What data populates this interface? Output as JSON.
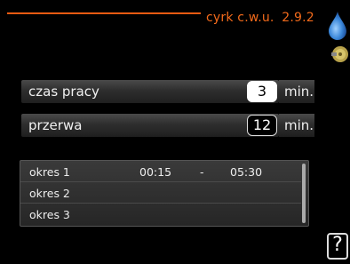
{
  "header": {
    "menu_title": "cyrk c.w.u.",
    "menu_number": "2.9.2"
  },
  "icons": {
    "water": "water-drop-icon",
    "hot_water": "hot-water-icon",
    "help": "help-icon"
  },
  "settings": [
    {
      "label": "czas pracy",
      "value": "3",
      "unit": "min."
    },
    {
      "label": "przerwa",
      "value": "12",
      "unit": "min."
    }
  ],
  "schedule": [
    {
      "label": "okres 1",
      "start": "00:15",
      "dash": "-",
      "end": "05:30"
    },
    {
      "label": "okres 2",
      "start": "",
      "dash": "",
      "end": ""
    },
    {
      "label": "okres 3",
      "start": "",
      "dash": "",
      "end": ""
    }
  ],
  "help_label": "?",
  "colors": {
    "accent": "#f26a1b",
    "background": "#000000",
    "water_blue": "#3a86d8"
  }
}
